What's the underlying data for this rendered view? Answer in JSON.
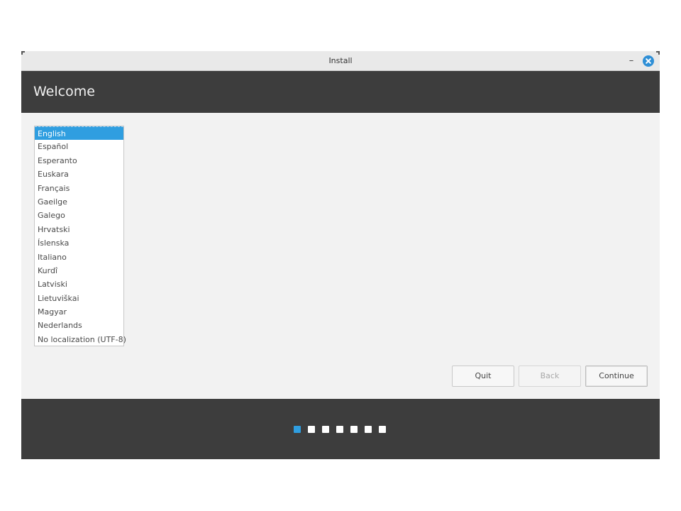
{
  "window": {
    "title": "Install",
    "minimize_glyph": "–"
  },
  "header": {
    "title": "Welcome"
  },
  "languages": {
    "items": [
      "English",
      "Español",
      "Esperanto",
      "Euskara",
      "Français",
      "Gaeilge",
      "Galego",
      "Hrvatski",
      "Íslenska",
      "Italiano",
      "Kurdî",
      "Latviski",
      "Lietuviškai",
      "Magyar",
      "Nederlands",
      "No localization (UTF-8)"
    ],
    "selected": "English"
  },
  "buttons": {
    "quit": "Quit",
    "back": "Back",
    "continue": "Continue"
  },
  "progress": {
    "total_steps": 7,
    "current_step": 1
  },
  "colors": {
    "accent": "#2f9ee0",
    "header_bg": "#3d3d3d",
    "close_button": "#2f8fd6"
  },
  "icons": {
    "close": "close-icon",
    "minimize": "minimize-icon"
  }
}
